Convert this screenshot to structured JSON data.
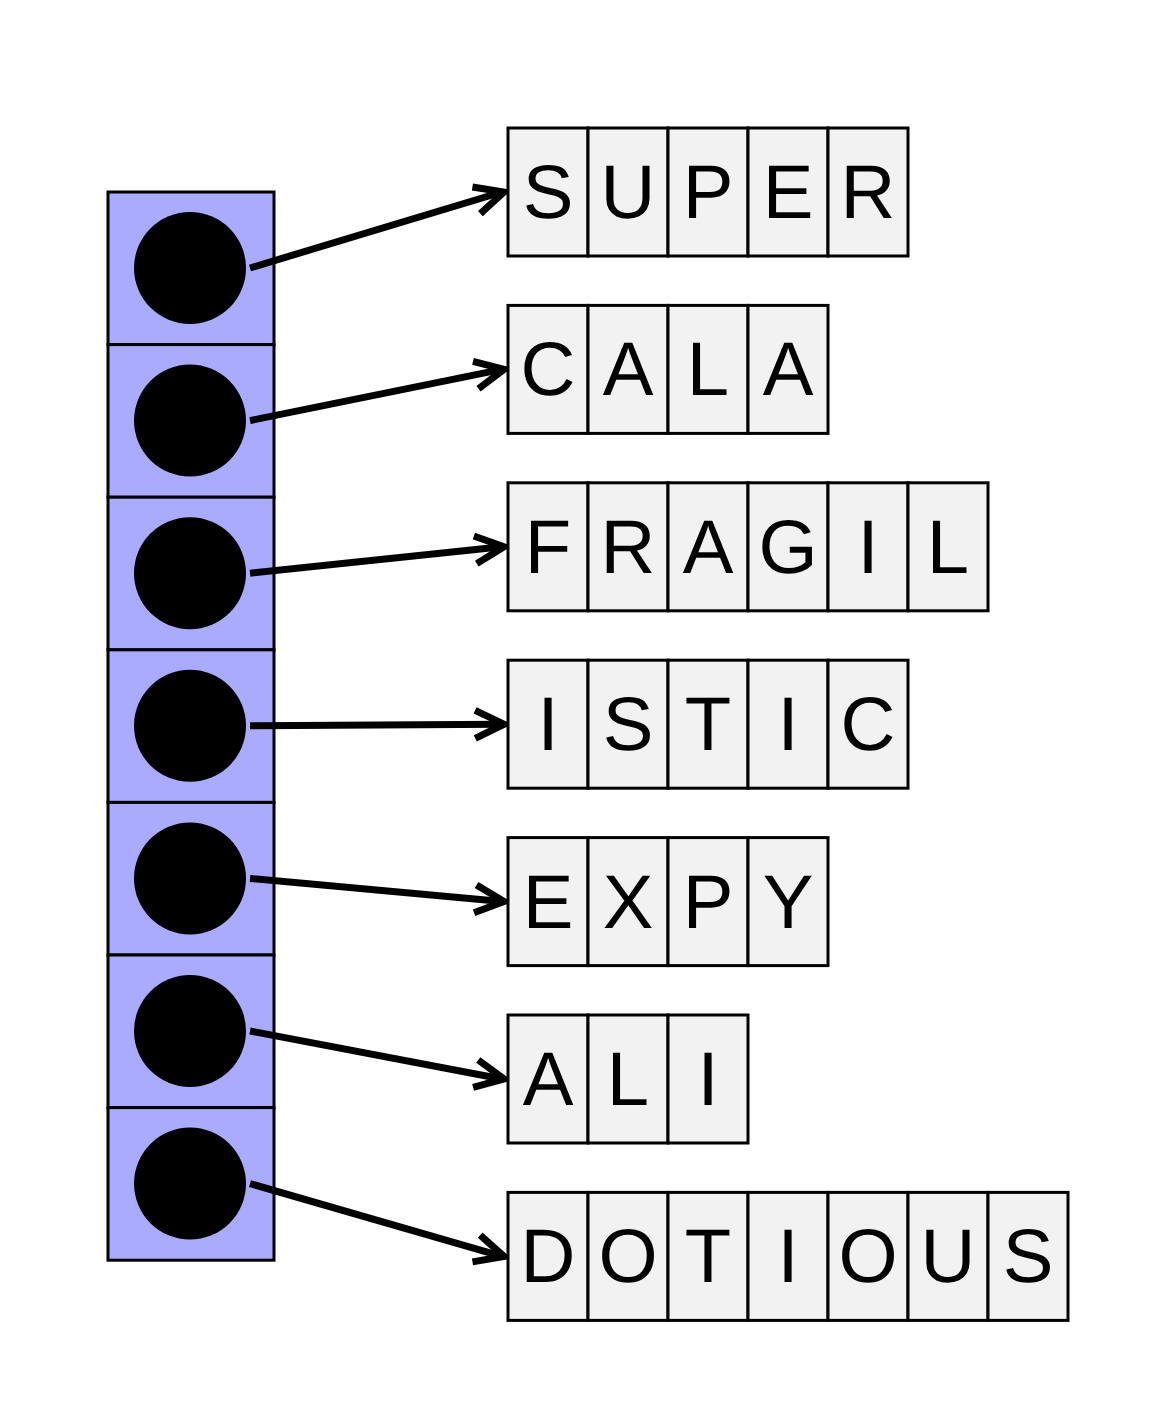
{
  "strings": [
    {
      "chars": [
        "S",
        "U",
        "P",
        "E",
        "R"
      ]
    },
    {
      "chars": [
        "C",
        "A",
        "L",
        "A"
      ]
    },
    {
      "chars": [
        "F",
        "R",
        "A",
        "G",
        "I",
        "L"
      ]
    },
    {
      "chars": [
        "I",
        "S",
        "T",
        "I",
        "C"
      ]
    },
    {
      "chars": [
        "E",
        "X",
        "P",
        "Y"
      ]
    },
    {
      "chars": [
        "A",
        "L",
        "I"
      ]
    },
    {
      "chars": [
        "D",
        "O",
        "T",
        "I",
        "O",
        "U",
        "S"
      ]
    }
  ]
}
